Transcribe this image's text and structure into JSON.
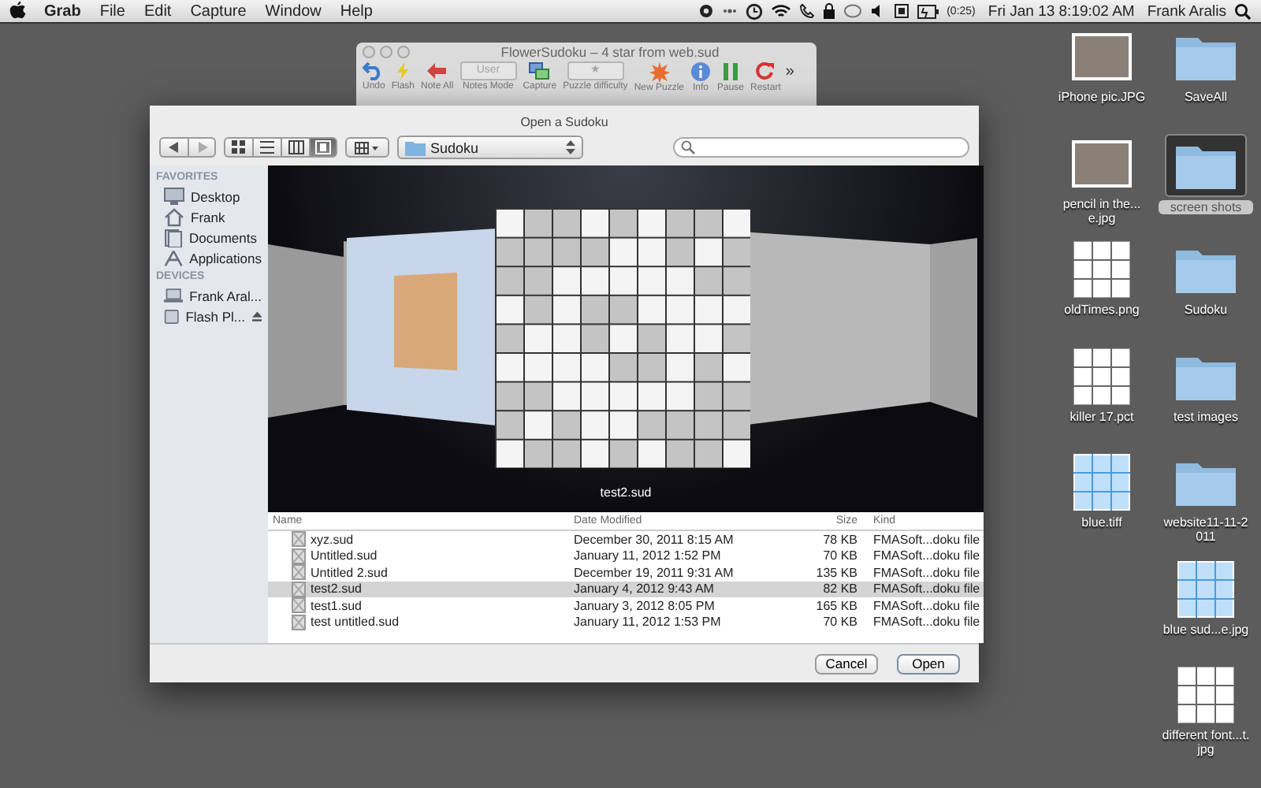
{
  "menubar": {
    "items": [
      {
        "label": "Grab",
        "bold": true
      },
      {
        "label": "File",
        "bold": false
      },
      {
        "label": "Edit",
        "bold": false
      },
      {
        "label": "Capture",
        "bold": false
      },
      {
        "label": "Window",
        "bold": false
      },
      {
        "label": "Help",
        "bold": false
      }
    ],
    "battery_time": "(0:25)",
    "clock": "Fri Jan 13  8:19:02 AM",
    "user": "Frank Aralis"
  },
  "app_window": {
    "title": "FlowerSudoku – 4 star from web.sud",
    "toolbar": [
      {
        "kind": "undo",
        "label": "Undo"
      },
      {
        "kind": "flash",
        "label": "Flash"
      },
      {
        "kind": "noteall",
        "label": "Note All"
      },
      {
        "kind": "popup",
        "label": "Notes Mode",
        "value": "User"
      },
      {
        "kind": "capture",
        "label": "Capture"
      },
      {
        "kind": "popup",
        "label": "Puzzle difficulty",
        "value": "★"
      },
      {
        "kind": "newpuzzle",
        "label": "New Puzzle"
      },
      {
        "kind": "info",
        "label": "Info"
      },
      {
        "kind": "pause",
        "label": "Pause"
      },
      {
        "kind": "restart",
        "label": "Restart"
      }
    ],
    "overflow": "»"
  },
  "dialog": {
    "title": "Open a Sudoku",
    "view_modes": [
      {
        "kind": "icons",
        "selected": false
      },
      {
        "kind": "list",
        "selected": false
      },
      {
        "kind": "columns",
        "selected": false
      },
      {
        "kind": "coverflow",
        "selected": true
      }
    ],
    "location": "Sudoku",
    "sidebar": [
      {
        "heading": "FAVORITES",
        "items": [
          {
            "kind": "desktop",
            "label": "Desktop",
            "selected": false,
            "eject": false
          },
          {
            "kind": "home",
            "label": "Frank",
            "selected": false,
            "eject": false
          },
          {
            "kind": "documents",
            "label": "Documents",
            "selected": false,
            "eject": false
          },
          {
            "kind": "applications",
            "label": "Applications",
            "selected": false,
            "eject": false
          }
        ]
      },
      {
        "heading": "DEVICES",
        "items": [
          {
            "kind": "computer",
            "label": "Frank Aral...",
            "selected": false,
            "eject": false
          },
          {
            "kind": "disk",
            "label": "Flash Pl...",
            "selected": false,
            "eject": true
          }
        ]
      }
    ],
    "preview_caption": "test2.sud",
    "columns": [
      "Name",
      "Date Modified",
      "Size",
      "Kind"
    ],
    "rows": [
      {
        "name": "xyz.sud",
        "date": "December 30, 2011 8:15 AM",
        "size": "78 KB",
        "kind": "FMASoft...doku file",
        "selected": false
      },
      {
        "name": "Untitled.sud",
        "date": "January 11, 2012 1:52 PM",
        "size": "70 KB",
        "kind": "FMASoft...doku file",
        "selected": false
      },
      {
        "name": "Untitled 2.sud",
        "date": "December 19, 2011 9:31 AM",
        "size": "135 KB",
        "kind": "FMASoft...doku file",
        "selected": false
      },
      {
        "name": "test2.sud",
        "date": "January 4, 2012 9:43 AM",
        "size": "82 KB",
        "kind": "FMASoft...doku file",
        "selected": true
      },
      {
        "name": "test1.sud",
        "date": "January 3, 2012 8:05 PM",
        "size": "165 KB",
        "kind": "FMASoft...doku file",
        "selected": false
      },
      {
        "name": "test untitled.sud",
        "date": "January 11, 2012 1:53 PM",
        "size": "70 KB",
        "kind": "FMASoft...doku file",
        "selected": false
      }
    ],
    "buttons": [
      {
        "label": "Cancel",
        "default": false
      },
      {
        "label": "Open",
        "default": true
      }
    ]
  },
  "desktop": {
    "columns": [
      [
        {
          "label": "iPhone pic.JPG",
          "kind": "photo",
          "selected": false
        },
        {
          "label": "pencil in the...e.jpg",
          "kind": "photo",
          "selected": false
        },
        {
          "label": "oldTimes.png",
          "kind": "puzzle",
          "selected": false
        },
        {
          "label": "killer 17.pct",
          "kind": "puzzle",
          "selected": false
        },
        {
          "label": "blue.tiff",
          "kind": "bluepuzzle",
          "selected": false
        }
      ],
      [
        {
          "label": "SaveAll",
          "kind": "folder",
          "selected": false
        },
        {
          "label": "screen shots",
          "kind": "folder",
          "selected": true
        },
        {
          "label": "Sudoku",
          "kind": "folder",
          "selected": false
        },
        {
          "label": "test images",
          "kind": "folder",
          "selected": false
        },
        {
          "label": "website11-11-2011",
          "kind": "folder",
          "selected": false
        },
        {
          "label": "blue sud...e.jpg",
          "kind": "bluepuzzle",
          "selected": false
        },
        {
          "label": "different font...t.jpg",
          "kind": "puzzle",
          "selected": false
        }
      ]
    ]
  }
}
